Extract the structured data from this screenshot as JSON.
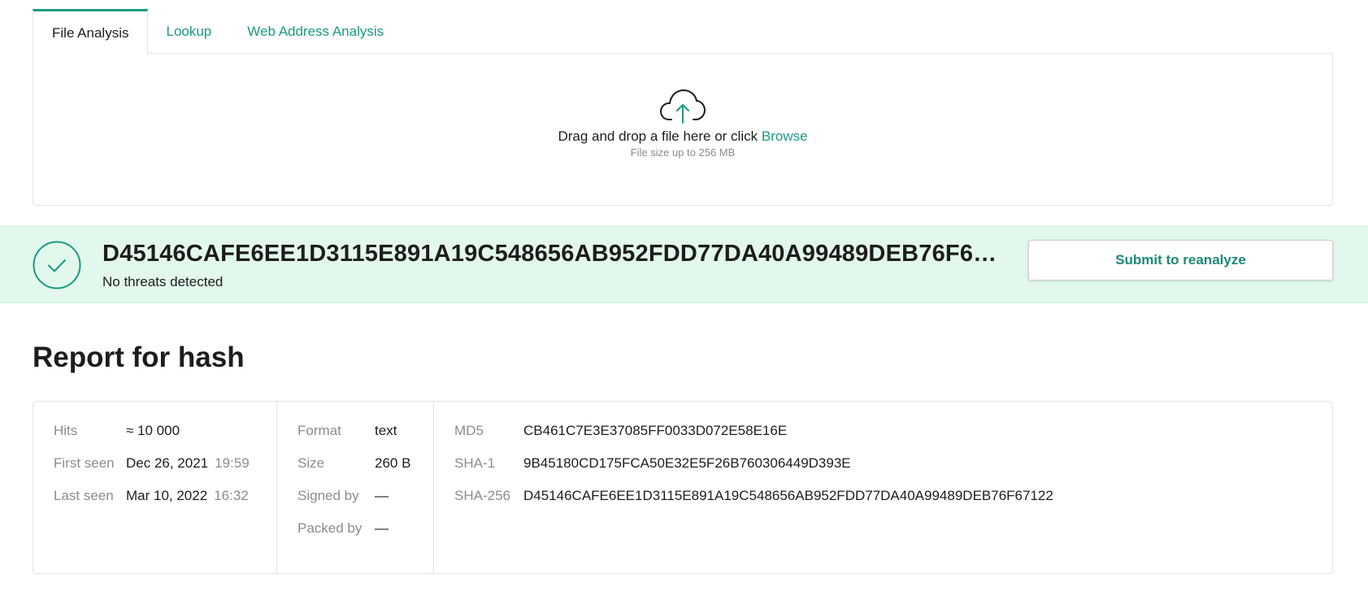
{
  "tabs": [
    {
      "label": "File Analysis",
      "active": true
    },
    {
      "label": "Lookup",
      "active": false
    },
    {
      "label": "Web Address Analysis",
      "active": false
    }
  ],
  "upload": {
    "icon": "cloud-upload-icon",
    "prompt": "Drag and drop a file here or click",
    "browse_label": "Browse",
    "size_hint": "File size up to 256 MB"
  },
  "result": {
    "icon": "check-circle-icon",
    "hash": "D45146CAFE6EE1D3115E891A19C548656AB952FDD77DA40A99489DEB76F67122",
    "verdict": "No threats detected",
    "reanalyze_label": "Submit to reanalyze"
  },
  "report": {
    "title": "Report for hash",
    "stats": {
      "hits_label": "Hits",
      "hits_value": "≈ 10 000",
      "first_seen_label": "First seen",
      "first_seen_date": "Dec 26, 2021",
      "first_seen_time": "19:59",
      "last_seen_label": "Last seen",
      "last_seen_date": "Mar 10, 2022",
      "last_seen_time": "16:32"
    },
    "file": {
      "format_label": "Format",
      "format_value": "text",
      "size_label": "Size",
      "size_value": "260 B",
      "signed_label": "Signed by",
      "signed_value": "—",
      "packed_label": "Packed by",
      "packed_value": "—"
    },
    "hashes": {
      "md5_label": "MD5",
      "md5_value": "CB461C7E3E37085FF0033D072E58E16E",
      "sha1_label": "SHA-1",
      "sha1_value": "9B45180CD175FCA50E32E5F26B760306449D393E",
      "sha256_label": "SHA-256",
      "sha256_value": "D45146CAFE6EE1D3115E891A19C548656AB952FDD77DA40A99489DEB76F67122"
    }
  },
  "colors": {
    "accent": "#1b9a82",
    "banner_bg": "#e2f8ec",
    "muted_text": "#8c8c8c",
    "border": "#e3e3e3"
  }
}
